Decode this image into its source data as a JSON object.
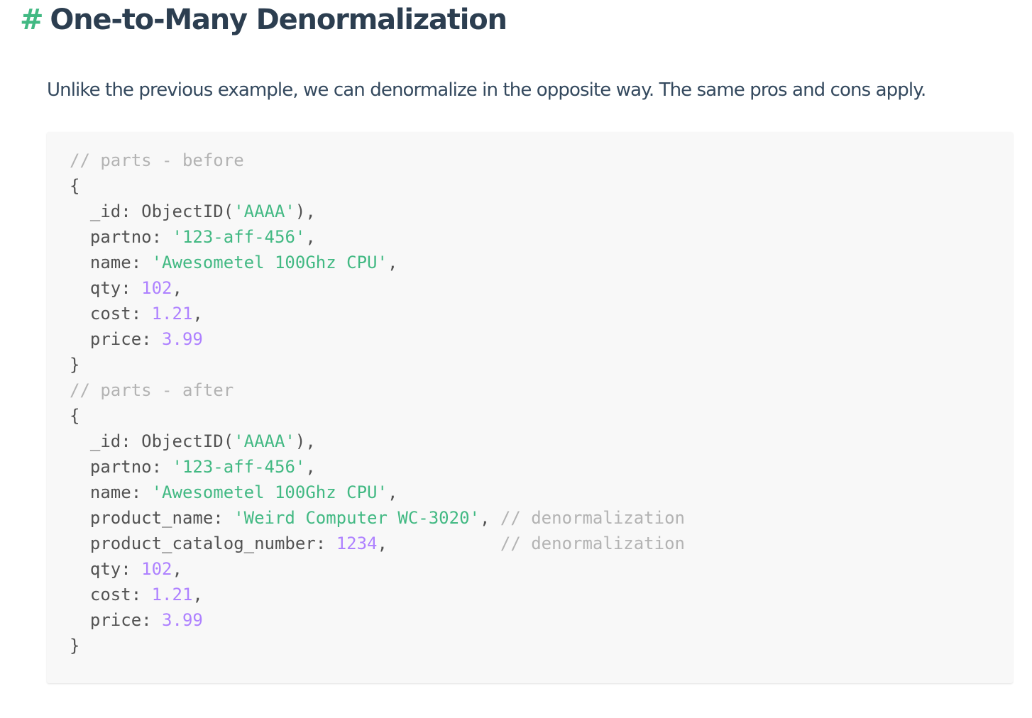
{
  "heading": {
    "hash": "#",
    "title": "One-to-Many Denormalization"
  },
  "lead": "Unlike the previous example, we can denormalize in the opposite way. The same pros and cons apply.",
  "code": {
    "lines": [
      [
        {
          "t": "// parts - before",
          "k": "comment"
        }
      ],
      [
        {
          "t": "{",
          "k": "plain"
        }
      ],
      [
        {
          "t": "  _id: ObjectID(",
          "k": "plain"
        },
        {
          "t": "'AAAA'",
          "k": "string"
        },
        {
          "t": "),",
          "k": "plain"
        }
      ],
      [
        {
          "t": "  partno: ",
          "k": "plain"
        },
        {
          "t": "'123-aff-456'",
          "k": "string"
        },
        {
          "t": ",",
          "k": "plain"
        }
      ],
      [
        {
          "t": "  name: ",
          "k": "plain"
        },
        {
          "t": "'Awesometel 100Ghz CPU'",
          "k": "string"
        },
        {
          "t": ",",
          "k": "plain"
        }
      ],
      [
        {
          "t": "  qty: ",
          "k": "plain"
        },
        {
          "t": "102",
          "k": "number"
        },
        {
          "t": ",",
          "k": "plain"
        }
      ],
      [
        {
          "t": "  cost: ",
          "k": "plain"
        },
        {
          "t": "1.21",
          "k": "number"
        },
        {
          "t": ",",
          "k": "plain"
        }
      ],
      [
        {
          "t": "  price: ",
          "k": "plain"
        },
        {
          "t": "3.99",
          "k": "number"
        }
      ],
      [
        {
          "t": "}",
          "k": "plain"
        }
      ],
      [
        {
          "t": "// parts - after",
          "k": "comment"
        }
      ],
      [
        {
          "t": "{",
          "k": "plain"
        }
      ],
      [
        {
          "t": "  _id: ObjectID(",
          "k": "plain"
        },
        {
          "t": "'AAAA'",
          "k": "string"
        },
        {
          "t": "),",
          "k": "plain"
        }
      ],
      [
        {
          "t": "  partno: ",
          "k": "plain"
        },
        {
          "t": "'123-aff-456'",
          "k": "string"
        },
        {
          "t": ",",
          "k": "plain"
        }
      ],
      [
        {
          "t": "  name: ",
          "k": "plain"
        },
        {
          "t": "'Awesometel 100Ghz CPU'",
          "k": "string"
        },
        {
          "t": ",",
          "k": "plain"
        }
      ],
      [
        {
          "t": "  product_name: ",
          "k": "plain"
        },
        {
          "t": "'Weird Computer WC-3020'",
          "k": "string"
        },
        {
          "t": ", ",
          "k": "plain"
        },
        {
          "t": "// denormalization",
          "k": "comment"
        }
      ],
      [
        {
          "t": "  product_catalog_number: ",
          "k": "plain"
        },
        {
          "t": "1234",
          "k": "number"
        },
        {
          "t": ",           ",
          "k": "plain"
        },
        {
          "t": "// denormalization",
          "k": "comment"
        }
      ],
      [
        {
          "t": "  qty: ",
          "k": "plain"
        },
        {
          "t": "102",
          "k": "number"
        },
        {
          "t": ",",
          "k": "plain"
        }
      ],
      [
        {
          "t": "  cost: ",
          "k": "plain"
        },
        {
          "t": "1.21",
          "k": "number"
        },
        {
          "t": ",",
          "k": "plain"
        }
      ],
      [
        {
          "t": "  price: ",
          "k": "plain"
        },
        {
          "t": "3.99",
          "k": "number"
        }
      ],
      [
        {
          "t": "}",
          "k": "plain"
        }
      ]
    ]
  }
}
